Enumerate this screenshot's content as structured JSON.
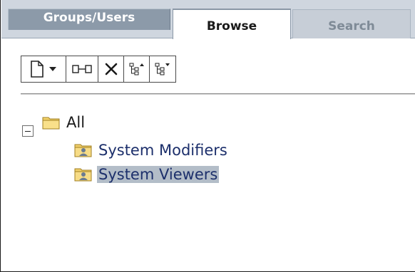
{
  "tabs": [
    {
      "label": "Groups/Users"
    },
    {
      "label": "Browse"
    },
    {
      "label": "Search"
    }
  ],
  "toolbar": {
    "new_icon": "new-document-icon",
    "dropdown_icon": "chevron-down-icon",
    "link_icon": "relation-icon",
    "delete_icon": "delete-icon",
    "move_up_icon": "tree-up-icon",
    "move_down_icon": "tree-down-icon"
  },
  "tree": {
    "root": {
      "label": "All",
      "expanded": true,
      "icon": "folder-icon"
    },
    "children": [
      {
        "label": "System Modifiers",
        "icon": "user-group-folder-icon",
        "selected": false
      },
      {
        "label": "System Viewers",
        "icon": "user-group-folder-icon",
        "selected": true
      }
    ]
  },
  "colors": {
    "tab_active_bg": "#ffffff",
    "tab_strip_bg": "#cfd6df",
    "tab_groups_bg": "#8c9aa9",
    "tree_link": "#1c2f6b",
    "selection_bg": "#b3bdc8"
  }
}
